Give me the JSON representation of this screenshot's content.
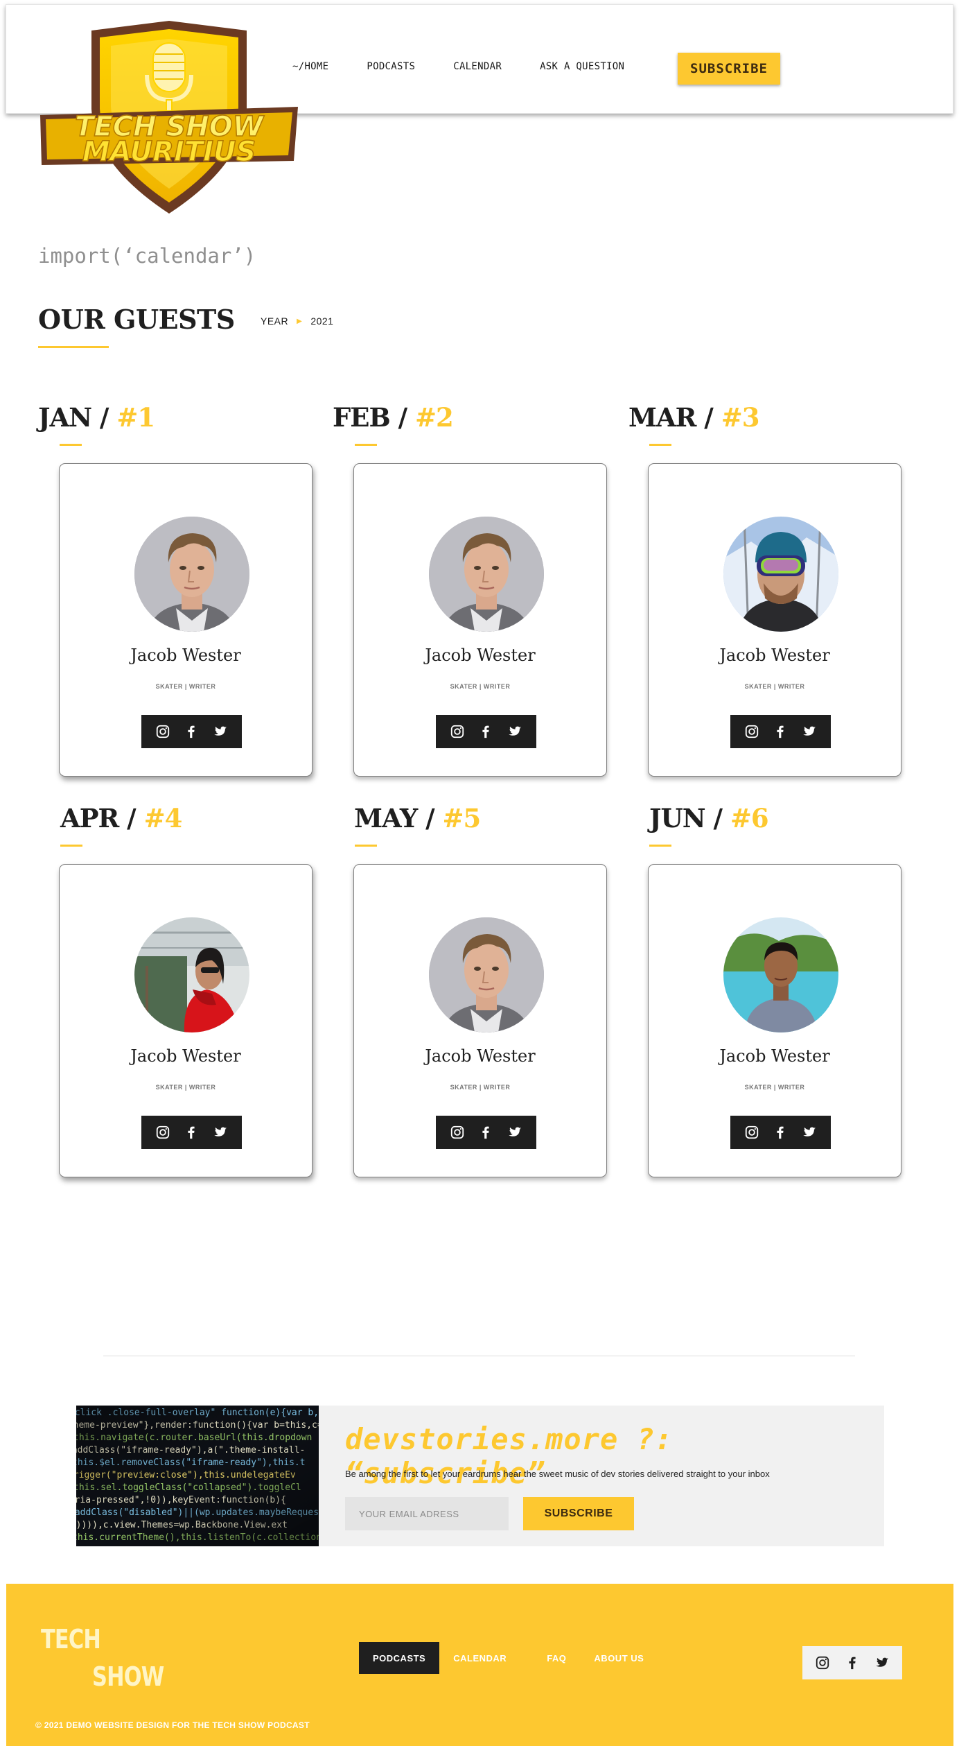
{
  "header": {
    "logo_line1": "TECH SHOW",
    "logo_line2": "MAURITIUS",
    "nav": [
      "~/HOME",
      "PODCASTS",
      "CALENDAR",
      "ASK A QUESTION"
    ],
    "subscribe_label": "SUBSCRIBE"
  },
  "page": {
    "import_text": "import(‘calendar’)",
    "title": "OUR GUESTS",
    "year_label": "YEAR",
    "year_value": "2021"
  },
  "guests": [
    {
      "month": "JAN /",
      "number": "#1",
      "name": "Jacob Wester",
      "role": "SKATER | WRITER",
      "photo": "young-man-portrait"
    },
    {
      "month": "FEB /",
      "number": "#2",
      "name": "Jacob Wester",
      "role": "SKATER | WRITER",
      "photo": "young-man-portrait"
    },
    {
      "month": "MAR /",
      "number": "#3",
      "name": "Jacob Wester",
      "role": "SKATER | WRITER",
      "photo": "skier-with-goggles"
    },
    {
      "month": "APR /",
      "number": "#4",
      "name": "Jacob Wester",
      "role": "SKATER | WRITER",
      "photo": "woman-in-red-jacket"
    },
    {
      "month": "MAY /",
      "number": "#5",
      "name": "Jacob Wester",
      "role": "SKATER | WRITER",
      "photo": "young-man-portrait"
    },
    {
      "month": "JUN /",
      "number": "#6",
      "name": "Jacob Wester",
      "role": "SKATER | WRITER",
      "photo": "man-by-lake"
    }
  ],
  "social_icons": [
    "instagram-icon",
    "facebook-icon",
    "twitter-icon"
  ],
  "newsletter": {
    "title": "devstories.more  ?: “subscribe”",
    "description": "Be among the first to let your eardrums hear the sweet music of dev stories delivered straight to your inbox",
    "email_placeholder": "YOUR EMAIL ADRESS",
    "button_label": "SUBSCRIBE"
  },
  "footer": {
    "logo_line1": "TECH",
    "logo_line2": "SHOW",
    "links": [
      "PODCASTS",
      "CALENDAR",
      "FAQ",
      "ABOUT US"
    ],
    "active_link": "PODCASTS",
    "copyright": "2021 DEMO WEBSITE DESIGN FOR THE TECH SHOW PODCAST"
  },
  "colors": {
    "accent": "#fdc830",
    "dark": "#1f1f1f",
    "muted": "#8f8f8f"
  }
}
